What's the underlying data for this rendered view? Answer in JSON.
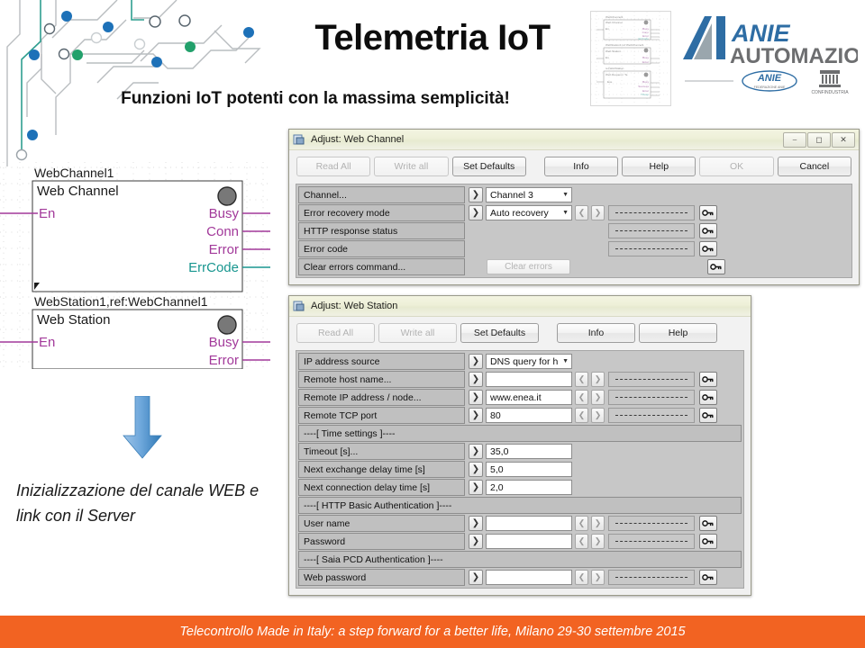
{
  "header": {
    "title": "Telemetria IoT",
    "subtitle": "Funzioni IoT potenti con la massima semplicità!",
    "logo_main": "ANIE",
    "logo_sub": "AUTOMAZIONE",
    "logo_badge1": "ANIE",
    "logo_badge2": "CONFINDUSTRIA"
  },
  "fbd": {
    "block1": {
      "instance": "WebChannel1",
      "type": "Web Channel",
      "input": "En",
      "outputs": [
        "Busy",
        "Conn",
        "Error",
        "ErrCode"
      ]
    },
    "block2": {
      "instance": "WebStation1,ref:WebChannel1",
      "type": "Web Station",
      "input": "En",
      "outputs": [
        "Busy",
        "Error"
      ]
    },
    "colors": {
      "bool_pin": "#a2399a",
      "int_pin": "#18968f",
      "wire_green": "#2f9e8f",
      "node_blue": "#1d71b8",
      "node_green": "#22a06b"
    }
  },
  "caption": "Inizializzazione del canale WEB e link con il Server",
  "dialog1": {
    "title": "Adjust: Web Channel",
    "window_buttons": [
      "minimize",
      "maximize",
      "close"
    ],
    "toolbar": [
      {
        "label": "Read All",
        "disabled": true
      },
      {
        "label": "Write all",
        "disabled": true
      },
      {
        "label": "Set Defaults",
        "disabled": false
      },
      {
        "label": "Info",
        "disabled": false
      },
      {
        "label": "Help",
        "disabled": false
      },
      {
        "label": "OK",
        "disabled": true
      },
      {
        "label": "Cancel",
        "disabled": false
      }
    ],
    "rows": [
      {
        "name": "Channel...",
        "kind": "select",
        "value": "Channel 3",
        "nav": false,
        "dash": false,
        "key": false
      },
      {
        "name": "Error recovery mode",
        "kind": "select",
        "value": "Auto recovery",
        "nav": true,
        "dash": true,
        "key": true
      },
      {
        "name": "HTTP response status",
        "kind": "empty",
        "value": "",
        "nav": false,
        "dash": true,
        "key": true
      },
      {
        "name": "Error code",
        "kind": "empty",
        "value": "",
        "nav": false,
        "dash": true,
        "key": true
      },
      {
        "name": "Clear errors command...",
        "kind": "button",
        "value": "Clear errors",
        "nav": false,
        "dash": false,
        "key": true
      }
    ]
  },
  "dialog2": {
    "title": "Adjust: Web Station",
    "toolbar": [
      {
        "label": "Read All",
        "disabled": true
      },
      {
        "label": "Write all",
        "disabled": true
      },
      {
        "label": "Set Defaults",
        "disabled": false
      },
      {
        "label": "Info",
        "disabled": false
      },
      {
        "label": "Help",
        "disabled": false
      }
    ],
    "rows": [
      {
        "name": "IP address source",
        "kind": "select",
        "value": "DNS query for h",
        "nav": false,
        "dash": false,
        "key": false
      },
      {
        "name": "Remote host name...",
        "kind": "text",
        "value": "",
        "nav": true,
        "dash": true,
        "key": true
      },
      {
        "name": "Remote IP address / node...",
        "kind": "text",
        "value": "www.enea.it",
        "nav": true,
        "dash": true,
        "key": true
      },
      {
        "name": "Remote TCP port",
        "kind": "text",
        "value": "80",
        "nav": true,
        "dash": true,
        "key": true
      },
      {
        "name": "----[ Time settings ]----",
        "kind": "section",
        "value": "",
        "nav": false,
        "dash": false,
        "key": false
      },
      {
        "name": "Timeout [s]...",
        "kind": "text",
        "value": "35,0",
        "nav": false,
        "dash": false,
        "key": false
      },
      {
        "name": "Next exchange delay time [s]",
        "kind": "text",
        "value": "5,0",
        "nav": false,
        "dash": false,
        "key": false
      },
      {
        "name": "Next connection delay time [s]",
        "kind": "text",
        "value": "2,0",
        "nav": false,
        "dash": false,
        "key": false
      },
      {
        "name": "----[ HTTP Basic Authentication ]----",
        "kind": "section",
        "value": "",
        "nav": false,
        "dash": false,
        "key": false
      },
      {
        "name": "User name",
        "kind": "text",
        "value": "",
        "nav": true,
        "dash": true,
        "key": true
      },
      {
        "name": "Password",
        "kind": "text",
        "value": "",
        "nav": true,
        "dash": true,
        "key": true
      },
      {
        "name": "----[ Saia PCD Authentication ]----",
        "kind": "section",
        "value": "",
        "nav": false,
        "dash": false,
        "key": false
      },
      {
        "name": "Web password",
        "kind": "text",
        "value": "",
        "nav": true,
        "dash": true,
        "key": true
      }
    ]
  },
  "footer": {
    "text": "Telecontrollo Made in Italy: a step forward for a better life, Milano 29-30 settembre 2015",
    "color": "#f26322"
  }
}
